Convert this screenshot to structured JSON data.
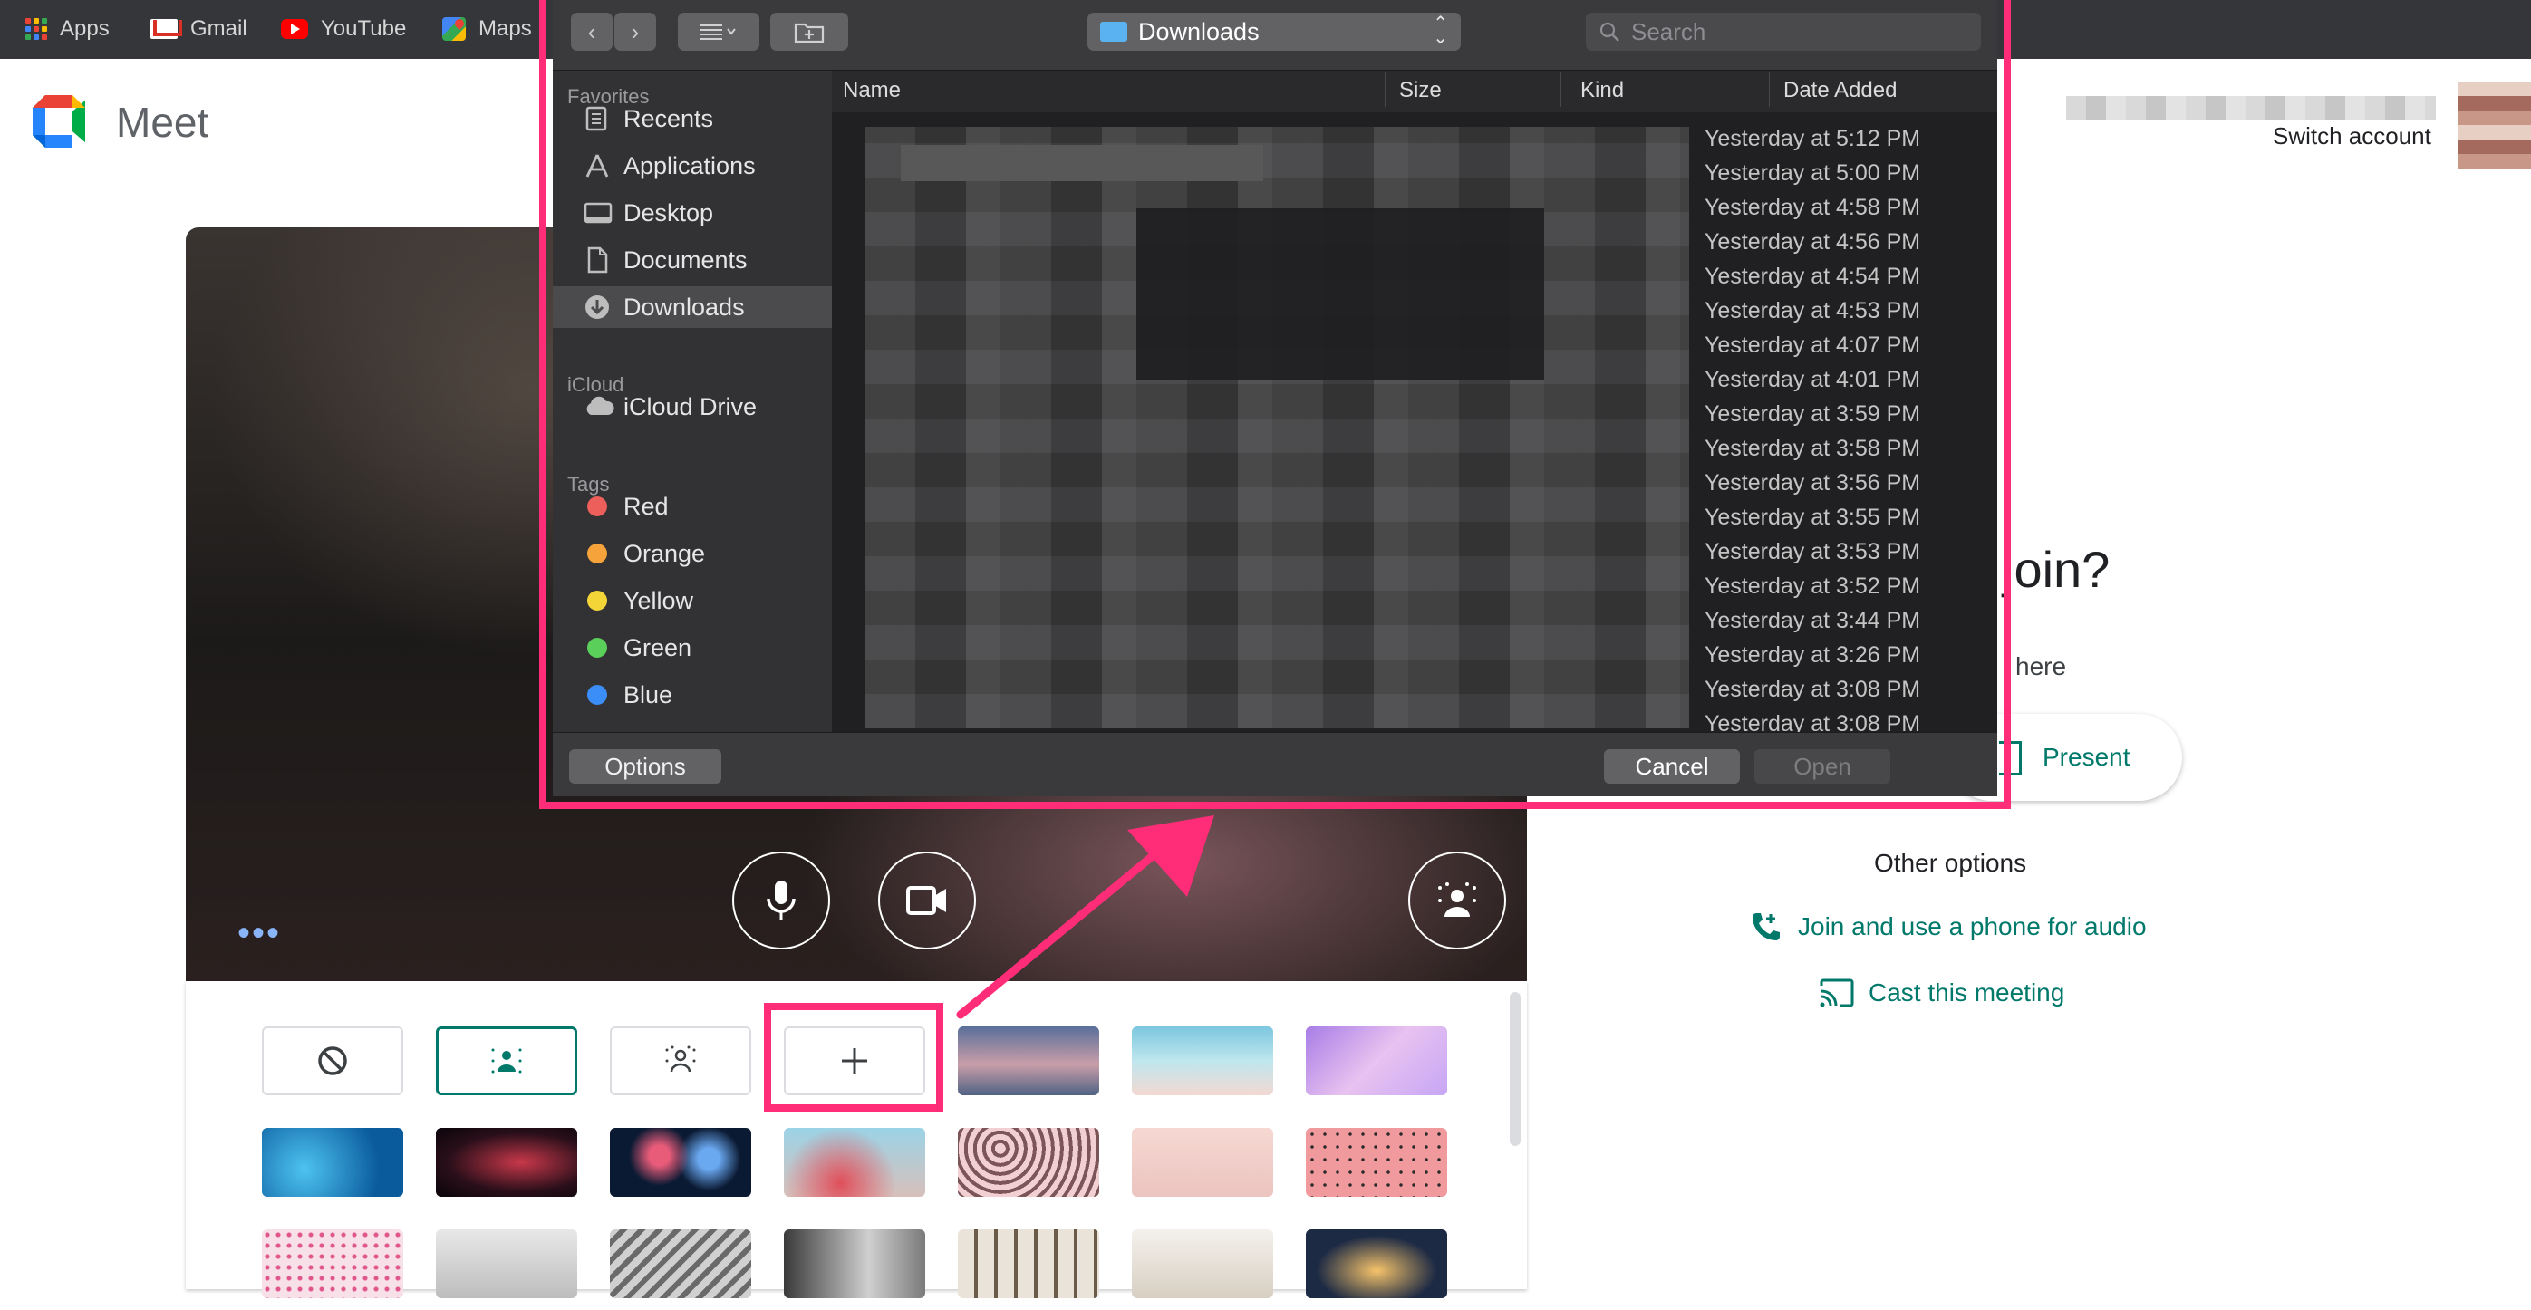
{
  "bookmarks": [
    {
      "label": "Apps",
      "icon": "apps-grid-icon"
    },
    {
      "label": "Gmail",
      "icon": "gmail-icon"
    },
    {
      "label": "YouTube",
      "icon": "youtube-icon"
    },
    {
      "label": "Maps",
      "icon": "maps-icon"
    }
  ],
  "meet": {
    "title": "Meet",
    "switch_account": "Switch account"
  },
  "right_panel": {
    "ready_heading_fragment": "join?",
    "no_one_fragment": "here",
    "present_label": "Present",
    "other_options": "Other options",
    "join_phone": "Join and use a phone for audio",
    "cast": "Cast this meeting"
  },
  "dialog": {
    "location": "Downloads",
    "search_placeholder": "Search",
    "sidebar": {
      "favorites_header": "Favorites",
      "favorites": [
        "Recents",
        "Applications",
        "Desktop",
        "Documents",
        "Downloads"
      ],
      "icloud_header": "iCloud",
      "icloud": [
        "iCloud Drive"
      ],
      "tags_header": "Tags",
      "tags": [
        {
          "label": "Red",
          "color": "#ec5f5a"
        },
        {
          "label": "Orange",
          "color": "#f5a33a"
        },
        {
          "label": "Yellow",
          "color": "#f4d538"
        },
        {
          "label": "Green",
          "color": "#5ad05a"
        },
        {
          "label": "Blue",
          "color": "#3b8ef7"
        }
      ]
    },
    "columns": [
      "Name",
      "Size",
      "Kind",
      "Date Added"
    ],
    "dates": [
      "Yesterday at 5:12 PM",
      "Yesterday at 5:00 PM",
      "Yesterday at 4:58 PM",
      "Yesterday at 4:56 PM",
      "Yesterday at 4:54 PM",
      "Yesterday at 4:53 PM",
      "Yesterday at 4:07 PM",
      "Yesterday at 4:01 PM",
      "Yesterday at 3:59 PM",
      "Yesterday at 3:58 PM",
      "Yesterday at 3:56 PM",
      "Yesterday at 3:55 PM",
      "Yesterday at 3:53 PM",
      "Yesterday at 3:52 PM",
      "Yesterday at 3:44 PM",
      "Yesterday at 3:26 PM",
      "Yesterday at 3:08 PM",
      "Yesterday at 3:08 PM"
    ],
    "options_label": "Options",
    "cancel_label": "Cancel",
    "open_label": "Open"
  },
  "colors": {
    "highlight": "#ff2d78",
    "meet_teal": "#00796b"
  }
}
